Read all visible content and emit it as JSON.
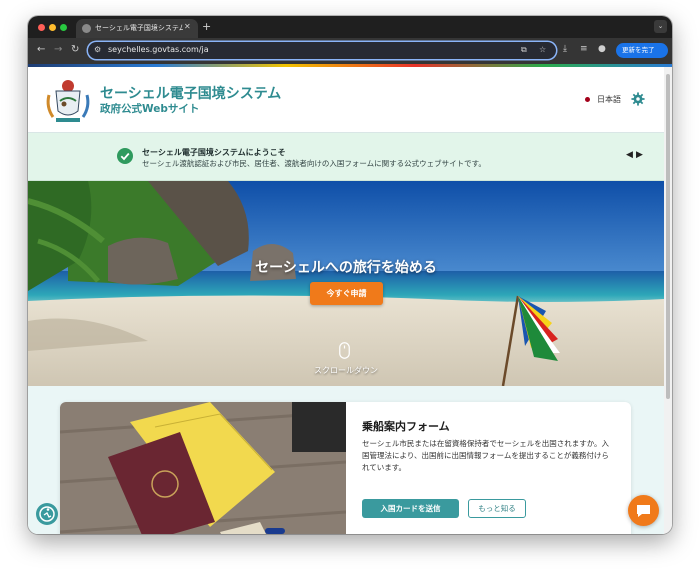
{
  "browser": {
    "tab_title": "セーシェル電子国境システム – 政",
    "url": "seychelles.govtas.com/ja",
    "update_button": "更新を完了"
  },
  "header": {
    "title": "セーシェル電子国境システム",
    "subtitle": "政府公式Webサイト",
    "language": "日本語"
  },
  "banner": {
    "title": "セーシェル電子国境システムにようこそ",
    "text": "セーシェル渡航認証および市民、居住者、渡航者向けの入国フォームに関する公式ウェブサイトです。"
  },
  "hero": {
    "title": "セーシェルへの旅行を始める",
    "button": "今すぐ申請",
    "scroll_label": "スクロールダウン"
  },
  "card": {
    "title": "乗船案内フォーム",
    "text": "セーシェル市民または在留資格保持者でセーシェルを出国されますか。入国管理法により、出国前に出国情報フォームを提出することが義務付けられています。",
    "primary_button": "入国カードを送信",
    "secondary_button": "もっと知る"
  },
  "colors": {
    "brand_teal": "#2e8b90",
    "accent_orange": "#f07a1a",
    "banner_bg": "#e2f5ea"
  }
}
